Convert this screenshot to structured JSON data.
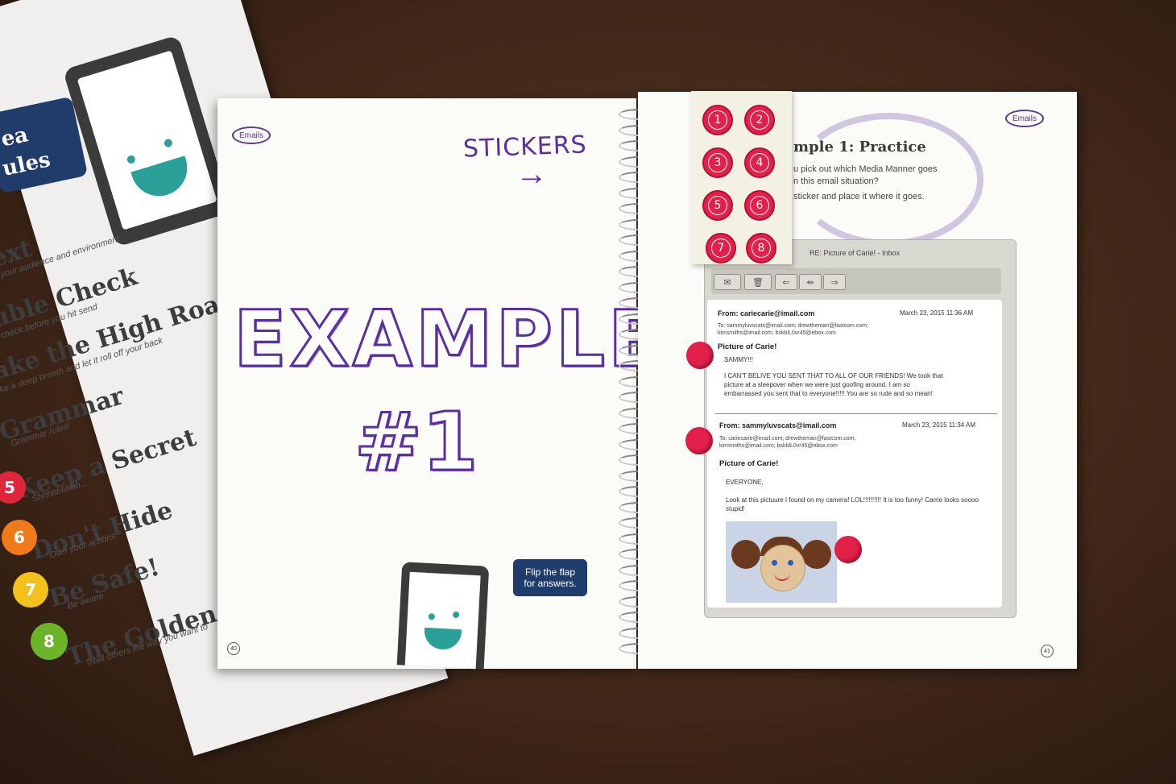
{
  "poster": {
    "idea_lines": [
      "ea",
      "ules"
    ],
    "rules": [
      {
        "title": "ext",
        "subtitle": "d your audience and environment"
      },
      {
        "title": "uble Check",
        "subtitle": "e check before you hit send"
      },
      {
        "title": "ake the High Road",
        "subtitle": "ake a deep breath and let it roll off your back"
      },
      {
        "title": "Grammar",
        "subtitle": "Grammar rules!"
      },
      {
        "title": "Keep a Secret",
        "subtitle": "Shhhhhhhhh..."
      },
      {
        "title": "Don't Hide",
        "subtitle": "Own your actions"
      },
      {
        "title": "Be Safe!",
        "subtitle": "Be aware"
      },
      {
        "title": "The Golden R",
        "subtitle": "Treat others the way you want to"
      }
    ],
    "rule_numbers": [
      "5",
      "6",
      "7",
      "8"
    ],
    "number_colors": [
      "#e0263a",
      "#f07a1a",
      "#f2c21a",
      "#6cb42a"
    ]
  },
  "left_page": {
    "tag": "Emails",
    "stickers_label": "STICKERS",
    "arrow": "→",
    "title": "EXAMPLE",
    "number": "#1",
    "flip_line1": "Flip the flap",
    "flip_line2": "for answers.",
    "page_number": "40"
  },
  "sticker_sheet": {
    "numbers": [
      "1",
      "2",
      "3",
      "4",
      "5",
      "6",
      "7",
      "8"
    ]
  },
  "right_page": {
    "tag": "Emails",
    "practice_title": "mple 1: Practice",
    "practice_line1": "u pick out which Media Manner goes",
    "practice_line2": "n this email situation?",
    "practice_line3": "sticker and place it where it goes.",
    "page_number": "41"
  },
  "mail": {
    "window_title": "RE: Picture of Carie! - Inbox",
    "toolbar": [
      "✉",
      "🗑",
      "⇐",
      "⇚",
      "⇒"
    ],
    "messages": [
      {
        "from": "From: cariecarie@imail.com",
        "date": "March 23, 2015 11:36 AM",
        "to1": "To: sammyluvscats@imail.com; drewtheman@fastcom.com;",
        "to2": "kimsmiths@imail.com; bskblL0vr45@ebox.com",
        "subject": "Picture of Carie!",
        "greeting": "SAMMY!!!",
        "body1": "I CAN'T BELIVE YOU SENT THAT TO ALL OF OUR FRIENDS! We took that",
        "body2": "picture at a sleepover when we were just goofing around. I am so",
        "body3": "embarrassed you sent that to everyone!!!!! You are so rude and so mean!"
      },
      {
        "from": "From: sammyluvscats@imail.com",
        "date": "March 23, 2015 11:34 AM",
        "to1": "To: cariecarie@imail.com; drewtheman@fastcom.com;",
        "to2": "kimsmiths@imail.com; bskblL0vr45@ebox.com",
        "subject": "Picture of Carie!",
        "greeting": "EVERYONE,",
        "body1": "Look at this pictuure I found on my camera! LOL!!!!!!!!!! It is too funny! Carrie looks soooo",
        "body2": "stupid!",
        "body3": ""
      }
    ]
  },
  "colors": {
    "purple": "#5a2fa0",
    "navy": "#1f3c6b",
    "sticker_red": "#e3204a"
  }
}
